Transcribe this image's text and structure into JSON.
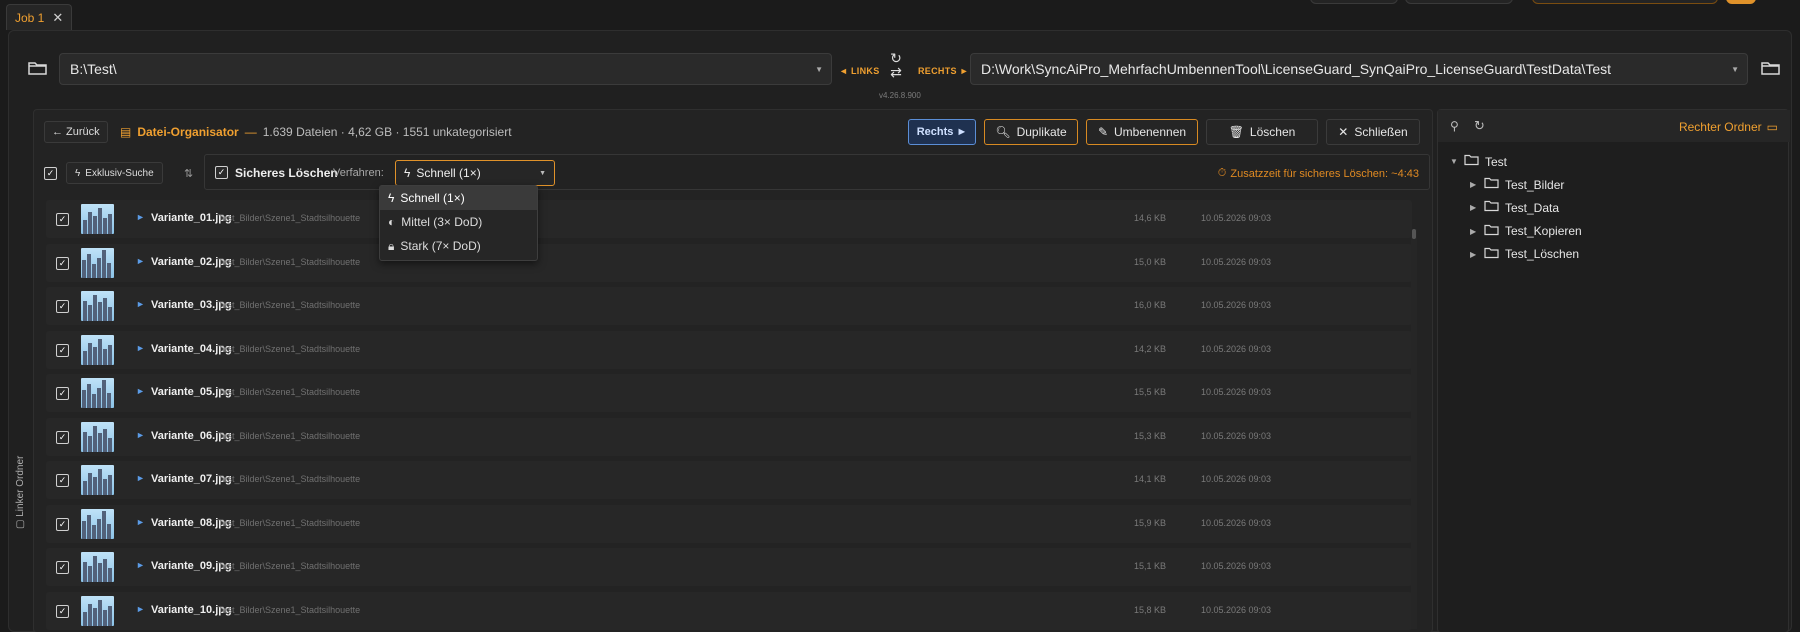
{
  "tab": {
    "label": "Job 1",
    "close": "✕"
  },
  "paths": {
    "left": "B:\\Test\\",
    "right": "D:\\Work\\SyncAiPro_MehrfachUmbennenTool\\LicenseGuard_SynQaiPro_LicenseGuard\\TestData\\Test",
    "links_label": "◄ LINKS",
    "rechts_label": "RECHTS ►",
    "version": "v4.26.8.900"
  },
  "sidebar": {
    "left_label": "Linker Ordner"
  },
  "organizer": {
    "back": "← Zurück",
    "title": "Datei-Organisator",
    "dash": "—",
    "stats": "1.639 Dateien · 4,62 GB · 1551 unkategorisiert",
    "buttons": {
      "rechts": "Rechts ►",
      "duplikate": "Duplikate",
      "umbenennen": "Umbenennen",
      "loeschen": "Löschen",
      "schliessen": "Schließen"
    },
    "exklusiv": "Exklusiv-Suche",
    "secure_label": "Sicheres Löschen",
    "verfahren_label": "Verfahren:",
    "selected_method": "Schnell (1×)",
    "zusatz": "Zusatzzeit für sicheres Löschen: ~4:43",
    "methods": [
      "Schnell (1×)",
      "Mittel (3× DoD)",
      "Stark (7× DoD)"
    ]
  },
  "files": [
    {
      "name": "Variante_01.jpg",
      "path": "Test_Bilder\\Szene1_Stadtsilhouette",
      "size": "14,6 KB",
      "date": "10.05.2026 09:03"
    },
    {
      "name": "Variante_02.jpg",
      "path": "Test_Bilder\\Szene1_Stadtsilhouette",
      "size": "15,0 KB",
      "date": "10.05.2026 09:03"
    },
    {
      "name": "Variante_03.jpg",
      "path": "Test_Bilder\\Szene1_Stadtsilhouette",
      "size": "16,0 KB",
      "date": "10.05.2026 09:03"
    },
    {
      "name": "Variante_04.jpg",
      "path": "Test_Bilder\\Szene1_Stadtsilhouette",
      "size": "14,2 KB",
      "date": "10.05.2026 09:03"
    },
    {
      "name": "Variante_05.jpg",
      "path": "Test_Bilder\\Szene1_Stadtsilhouette",
      "size": "15,5 KB",
      "date": "10.05.2026 09:03"
    },
    {
      "name": "Variante_06.jpg",
      "path": "Test_Bilder\\Szene1_Stadtsilhouette",
      "size": "15,3 KB",
      "date": "10.05.2026 09:03"
    },
    {
      "name": "Variante_07.jpg",
      "path": "Test_Bilder\\Szene1_Stadtsilhouette",
      "size": "14,1 KB",
      "date": "10.05.2026 09:03"
    },
    {
      "name": "Variante_08.jpg",
      "path": "Test_Bilder\\Szene1_Stadtsilhouette",
      "size": "15,9 KB",
      "date": "10.05.2026 09:03"
    },
    {
      "name": "Variante_09.jpg",
      "path": "Test_Bilder\\Szene1_Stadtsilhouette",
      "size": "15,1 KB",
      "date": "10.05.2026 09:03"
    },
    {
      "name": "Variante_10.jpg",
      "path": "Test_Bilder\\Szene1_Stadtsilhouette",
      "size": "15,8 KB",
      "date": "10.05.2026 09:03"
    }
  ],
  "right_panel": {
    "title": "Rechter Ordner",
    "root": "Test",
    "children": [
      "Test_Bilder",
      "Test_Data",
      "Test_Kopieren",
      "Test_Löschen"
    ]
  },
  "colors": {
    "accent": "#f0a030",
    "blue": "#5b8ed6",
    "background": "#1b1b1b"
  }
}
